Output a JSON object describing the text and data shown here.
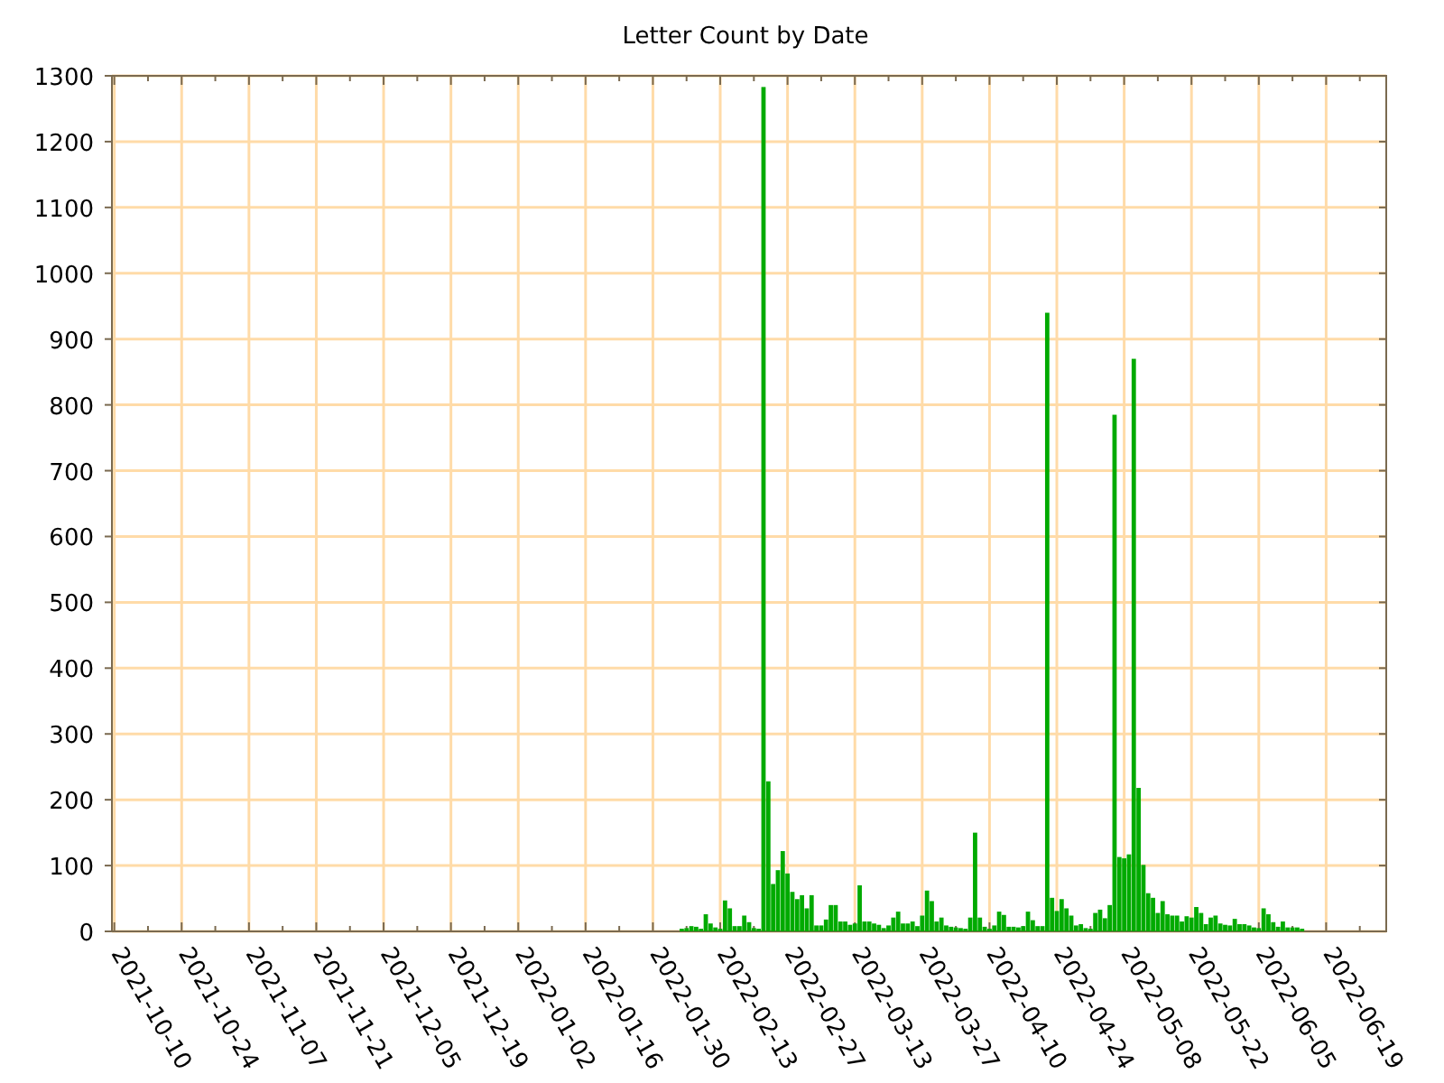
{
  "chart_data": {
    "type": "bar",
    "title": "Letter Count by Date",
    "categories": [
      "2021-10-10",
      null,
      null,
      null,
      null,
      null,
      null,
      null,
      null,
      null,
      null,
      null,
      null,
      null,
      "2021-10-24",
      null,
      null,
      null,
      null,
      null,
      null,
      null,
      null,
      null,
      null,
      null,
      null,
      null,
      "2021-11-07",
      null,
      null,
      null,
      null,
      null,
      null,
      null,
      null,
      null,
      null,
      null,
      null,
      null,
      "2021-11-21",
      null,
      null,
      null,
      null,
      null,
      null,
      null,
      null,
      null,
      null,
      null,
      null,
      null,
      "2021-12-05",
      null,
      null,
      null,
      null,
      null,
      null,
      null,
      null,
      null,
      null,
      null,
      null,
      null,
      "2021-12-19",
      null,
      null,
      null,
      null,
      null,
      null,
      null,
      null,
      null,
      null,
      null,
      null,
      null,
      "2022-01-02",
      null,
      null,
      null,
      null,
      null,
      null,
      null,
      null,
      null,
      null,
      null,
      null,
      null,
      "2022-01-16",
      null,
      null,
      null,
      null,
      null,
      null,
      null,
      null,
      null,
      null,
      null,
      null,
      null,
      "2022-01-30",
      null,
      null,
      null,
      null,
      null,
      null,
      null,
      null,
      null,
      null,
      null,
      null,
      null,
      "2022-02-13",
      null,
      null,
      null,
      null,
      null,
      null,
      null,
      null,
      null,
      null,
      null,
      null,
      null,
      "2022-02-27",
      null,
      null,
      null,
      null,
      null,
      null,
      null,
      null,
      null,
      null,
      null,
      null,
      null,
      "2022-03-13",
      null,
      null,
      null,
      null,
      null,
      null,
      null,
      null,
      null,
      null,
      null,
      null,
      null,
      "2022-03-27",
      null,
      null,
      null,
      null,
      null,
      null,
      null,
      null,
      null,
      null,
      null,
      null,
      null,
      "2022-04-10",
      null,
      null,
      null,
      null,
      null,
      null,
      null,
      null,
      null,
      null,
      null,
      null,
      null,
      "2022-04-24",
      null,
      null,
      null,
      null,
      null,
      null,
      null,
      null,
      null,
      null,
      null,
      null,
      null,
      "2022-05-08",
      null,
      null,
      null,
      null,
      null,
      null,
      null,
      null,
      null,
      null,
      null,
      null,
      null,
      "2022-05-22",
      null,
      null,
      null,
      null,
      null,
      null,
      null,
      null,
      null,
      null,
      null,
      null,
      null,
      "2022-06-05",
      null,
      null,
      null,
      null,
      null,
      null,
      null,
      null,
      null,
      null,
      null,
      null,
      null,
      "2022-06-19",
      null,
      null,
      null,
      null,
      null,
      null,
      null,
      null,
      null,
      null,
      null,
      null
    ],
    "series": [
      {
        "color": "#00aa00",
        "values": [
          null,
          null,
          null,
          null,
          null,
          null,
          null,
          null,
          null,
          null,
          null,
          null,
          null,
          null,
          null,
          null,
          null,
          null,
          null,
          null,
          null,
          null,
          null,
          null,
          null,
          null,
          null,
          null,
          null,
          null,
          null,
          null,
          null,
          null,
          null,
          null,
          null,
          null,
          null,
          null,
          null,
          null,
          null,
          null,
          null,
          null,
          null,
          null,
          null,
          null,
          null,
          null,
          null,
          null,
          null,
          null,
          null,
          null,
          null,
          null,
          null,
          null,
          null,
          null,
          null,
          null,
          null,
          null,
          null,
          null,
          null,
          null,
          null,
          null,
          null,
          null,
          null,
          null,
          null,
          null,
          null,
          null,
          null,
          null,
          null,
          null,
          null,
          null,
          null,
          null,
          null,
          null,
          null,
          null,
          null,
          null,
          null,
          null,
          null,
          null,
          null,
          null,
          null,
          null,
          null,
          null,
          null,
          null,
          null,
          null,
          null,
          null,
          null,
          null,
          null,
          null,
          null,
          null,
          4,
          5,
          8,
          7,
          4,
          26,
          12,
          6,
          4,
          47,
          35,
          8,
          8,
          24,
          14,
          5,
          4,
          1283,
          228,
          72,
          93,
          122,
          88,
          60,
          49,
          55,
          35,
          55,
          9,
          9,
          18,
          40,
          40,
          15,
          15,
          10,
          12,
          70,
          15,
          15,
          12,
          10,
          5,
          9,
          21,
          30,
          12,
          12,
          15,
          8,
          24,
          62,
          46,
          15,
          21,
          9,
          7,
          6,
          5,
          4,
          21,
          150,
          21,
          7,
          4,
          9,
          30,
          25,
          7,
          7,
          6,
          8,
          30,
          17,
          8,
          8,
          940,
          51,
          31,
          49,
          35,
          24,
          9,
          11,
          5,
          4,
          28,
          33,
          20,
          40,
          785,
          113,
          111,
          117,
          870,
          218,
          101,
          58,
          51,
          28,
          46,
          26,
          24,
          24,
          15,
          23,
          21,
          37,
          28,
          11,
          21,
          24,
          12,
          10,
          9,
          19,
          11,
          11,
          9,
          6,
          5,
          35,
          26,
          14,
          7,
          15,
          6,
          6,
          6,
          4,
          null,
          null,
          null,
          null,
          null,
          null,
          null,
          null,
          null,
          null,
          null,
          null,
          null,
          null,
          null,
          null,
          null
        ]
      }
    ],
    "grid": true,
    "ylim": [
      0,
      1300
    ],
    "yticks": [
      0,
      100,
      200,
      300,
      400,
      500,
      600,
      700,
      800,
      900,
      1000,
      1100,
      1200,
      1300
    ]
  }
}
